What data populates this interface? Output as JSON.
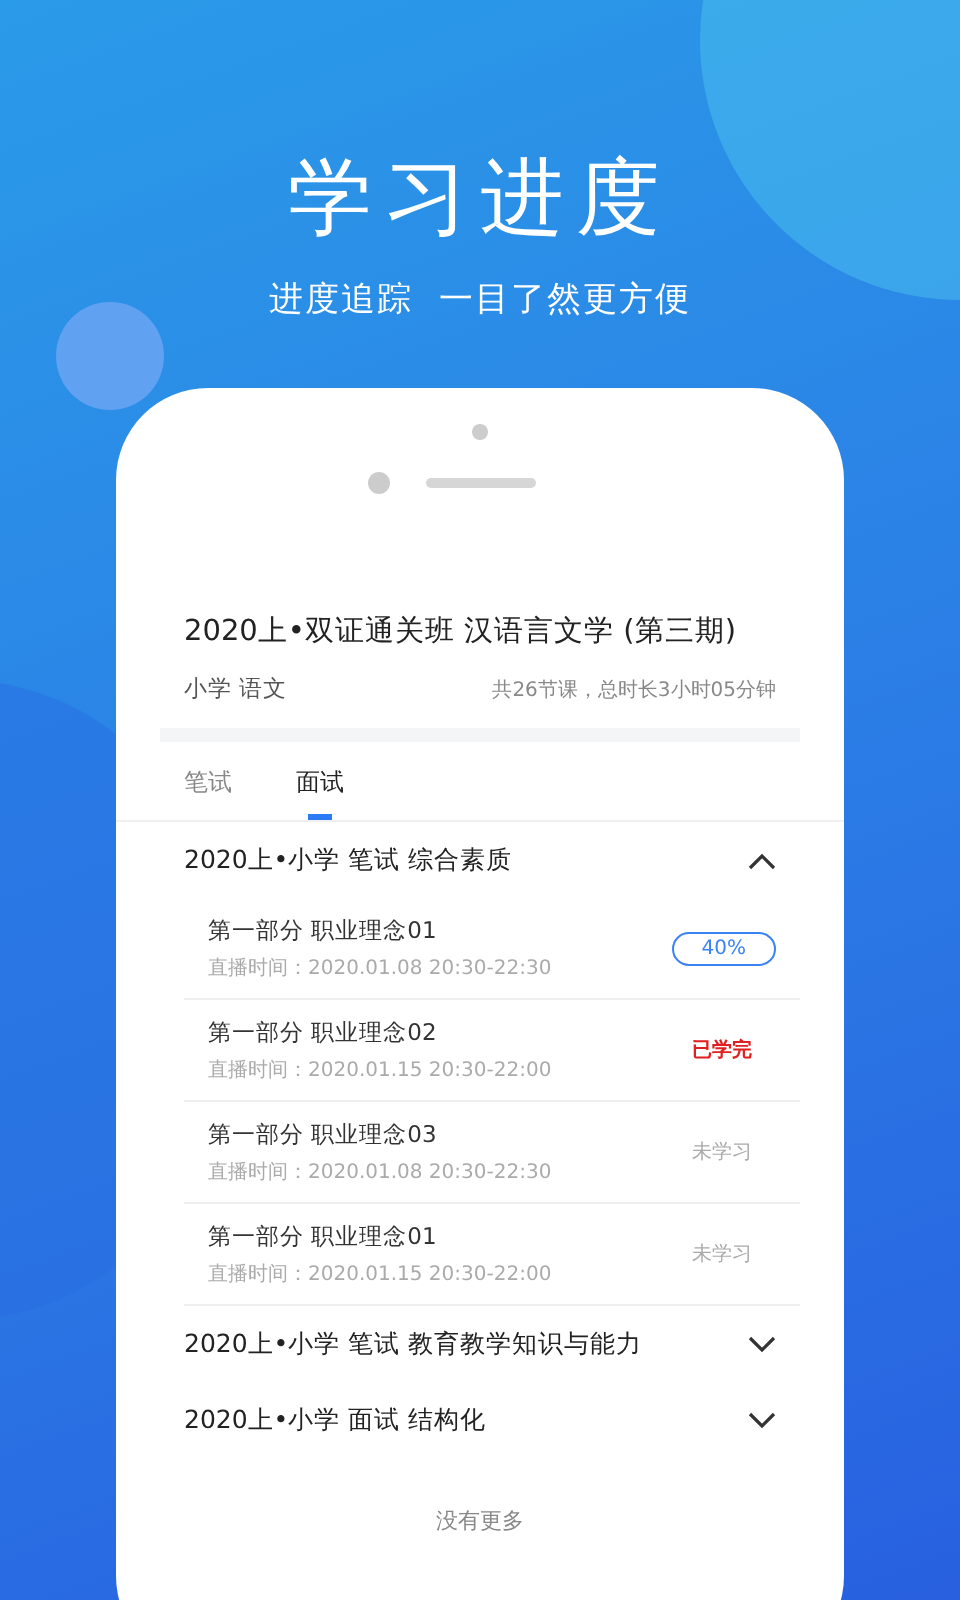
{
  "headline": "学习进度",
  "tagline": "进度追踪  一目了然更方便",
  "course": {
    "title": "2020上•双证通关班 汉语言文学 (第三期)",
    "subject": "小学 语文",
    "summary": "共26节课，总时长3小时05分钟"
  },
  "tabs": [
    {
      "label": "笔试",
      "selected": false
    },
    {
      "label": "面试",
      "selected": true
    }
  ],
  "sections": [
    {
      "title": "2020上•小学 笔试 综合素质",
      "expanded": true,
      "lessons": [
        {
          "title": "第一部分 职业理念01",
          "time": "直播时间：2020.01.08 20:30-22:30",
          "kind": "progress",
          "status": "40%"
        },
        {
          "title": "第一部分 职业理念02",
          "time": "直播时间：2020.01.15 20:30-22:00",
          "kind": "done",
          "status": "已学完"
        },
        {
          "title": "第一部分 职业理念03",
          "time": "直播时间：2020.01.08 20:30-22:30",
          "kind": "todo",
          "status": "未学习"
        },
        {
          "title": "第一部分 职业理念01",
          "time": "直播时间：2020.01.15 20:30-22:00",
          "kind": "todo",
          "status": "未学习"
        }
      ]
    },
    {
      "title": "2020上•小学 笔试 教育教学知识与能力",
      "expanded": false
    },
    {
      "title": "2020上•小学 面试 结构化",
      "expanded": false
    }
  ],
  "footer": "没有更多"
}
